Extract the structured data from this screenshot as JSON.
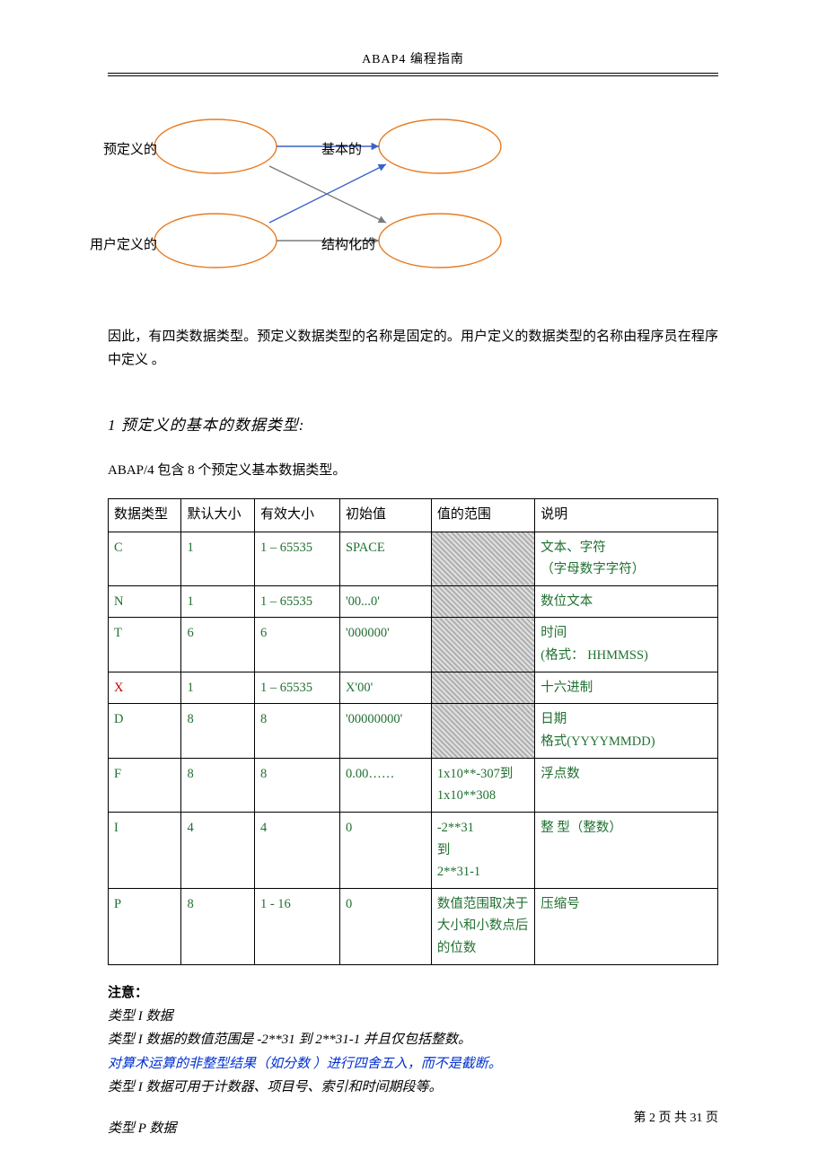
{
  "header": {
    "title": "ABAP4  编程指南"
  },
  "diagram": {
    "label_predef": "预定义的",
    "label_basic": "基本的",
    "label_userdef": "用户定义的",
    "label_struct": "结构化的"
  },
  "para1": "因此，有四类数据类型。预定义数据类型的名称是固定的。用户定义的数据类型的名称由程序员在程序中定义  。",
  "section": {
    "title": "1  预定义的基本的数据类型:"
  },
  "intro": "ABAP/4  包含  8  个预定义基本数据类型。",
  "table": {
    "headers": [
      "数据类型",
      "默认大小",
      "有效大小",
      "初始值",
      "值的范围",
      "说明"
    ],
    "rows": [
      {
        "type": "C",
        "type_color": "green",
        "def": "1",
        "valid": "1 – 65535",
        "init": "SPACE",
        "range": "",
        "range_hatched": true,
        "desc": "文本、字符\n（字母数字字符）"
      },
      {
        "type": "N",
        "type_color": "green",
        "def": "1",
        "valid": "1 – 65535",
        "init": "'00...0'",
        "range": "",
        "range_hatched": true,
        "desc": "数位文本"
      },
      {
        "type": "T",
        "type_color": "green",
        "def": "6",
        "valid": "6",
        "init": "'000000'",
        "range": "",
        "range_hatched": true,
        "desc": "时间\n(格式：  HHMMSS)"
      },
      {
        "type": "X",
        "type_color": "red",
        "def": "1",
        "valid": "1 – 65535",
        "init": "X'00'",
        "range": "",
        "range_hatched": true,
        "desc": "十六进制"
      },
      {
        "type": "D",
        "type_color": "green",
        "def": "8",
        "valid": "8",
        "init": "'00000000'",
        "range": "",
        "range_hatched": true,
        "desc": "日期\n格式(YYYYMMDD)",
        "desc_justify": true
      },
      {
        "type": "F",
        "type_color": "green",
        "def": "8",
        "valid": "8",
        "init": "0.00……",
        "range": "1x10**-307到  1x10**308",
        "range_hatched": false,
        "desc": "浮点数"
      },
      {
        "type": "I",
        "type_color": "green",
        "def": "4",
        "valid": "4",
        "init": "0",
        "range": "-2**31\n到\n2**31-1",
        "range_hatched": false,
        "desc": "整 型（整数）"
      },
      {
        "type": "P",
        "type_color": "green",
        "def": "8",
        "valid": "1 - 16",
        "init": "0",
        "range": "数值范围取决于大小和小数点后的位数",
        "range_hatched": false,
        "range_justify": true,
        "desc": "压缩号"
      }
    ]
  },
  "notes": {
    "heading": "注意：",
    "l1": "类型 I  数据",
    "l2": "类型 I  数据的数值范围是  -2**31  到  2**31-1  并且仅包括整数。",
    "l3": "对算术运算的非整型结果（如分数  ）进行四舍五入，而不是截断。",
    "l4": "类型 I  数据可用于计数器、项目号、索引和时间期段等。",
    "l5": "类型 P  数据"
  },
  "footer": {
    "text": "第  2 页  共  31 页"
  }
}
